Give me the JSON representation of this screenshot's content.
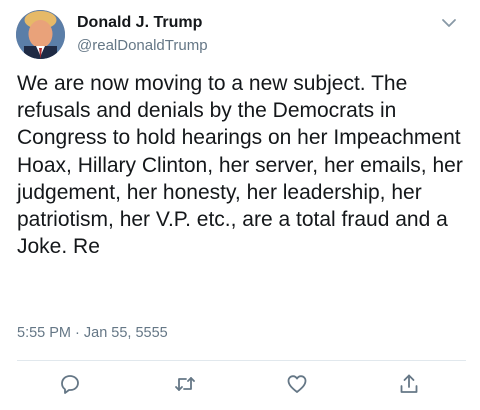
{
  "tweet": {
    "display_name": "Donald J. Trump",
    "handle": "@realDonaldTrump",
    "text": "We are now moving to a new subject. The refusals and denials by the Democrats in Congress to hold hearings on her Impeachment Hoax, Hillary Clinton, her server, her emails, her judgement, her honesty, her leadership, her patriotism, her V.P. etc., are a total fraud and a Joke. Re",
    "timestamp": "5:55 PM · Jan 55, 5555"
  },
  "icons": {
    "caret": "chevron-down-icon",
    "reply": "reply-icon",
    "retweet": "retweet-icon",
    "like": "heart-icon",
    "share": "share-icon"
  },
  "colors": {
    "text": "#14171a",
    "secondary": "#657786",
    "divider": "#e1e8ed",
    "icon": "#657786"
  }
}
